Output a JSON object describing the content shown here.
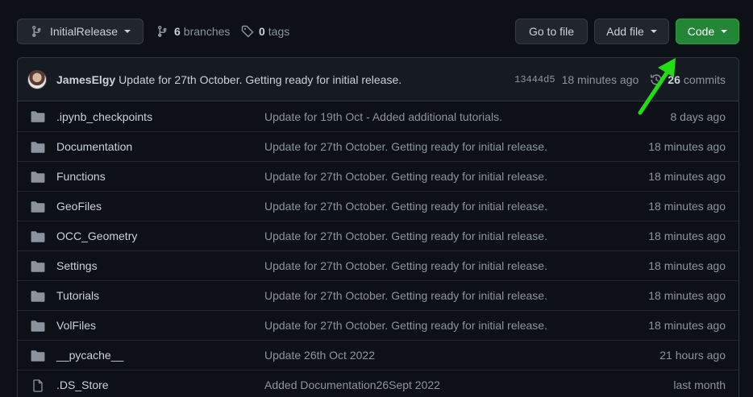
{
  "branch": {
    "name": "InitialRelease"
  },
  "branches": {
    "count": "6",
    "label": "branches"
  },
  "tags": {
    "count": "0",
    "label": "tags"
  },
  "buttons": {
    "goto": "Go to file",
    "add": "Add file",
    "code": "Code"
  },
  "commit": {
    "author": "JamesElgy",
    "message": "Update for 27th October. Getting ready for initial release.",
    "sha": "13444d5",
    "time": "18 minutes ago",
    "count": "26",
    "count_label": "commits"
  },
  "files": [
    {
      "type": "folder",
      "name": ".ipynb_checkpoints",
      "message": "Update for 19th Oct - Added additional tutorials.",
      "age": "8 days ago"
    },
    {
      "type": "folder",
      "name": "Documentation",
      "message": "Update for 27th October. Getting ready for initial release.",
      "age": "18 minutes ago"
    },
    {
      "type": "folder",
      "name": "Functions",
      "message": "Update for 27th October. Getting ready for initial release.",
      "age": "18 minutes ago"
    },
    {
      "type": "folder",
      "name": "GeoFiles",
      "message": "Update for 27th October. Getting ready for initial release.",
      "age": "18 minutes ago"
    },
    {
      "type": "folder",
      "name": "OCC_Geometry",
      "message": "Update for 27th October. Getting ready for initial release.",
      "age": "18 minutes ago"
    },
    {
      "type": "folder",
      "name": "Settings",
      "message": "Update for 27th October. Getting ready for initial release.",
      "age": "18 minutes ago"
    },
    {
      "type": "folder",
      "name": "Tutorials",
      "message": "Update for 27th October. Getting ready for initial release.",
      "age": "18 minutes ago"
    },
    {
      "type": "folder",
      "name": "VolFiles",
      "message": "Update for 27th October. Getting ready for initial release.",
      "age": "18 minutes ago"
    },
    {
      "type": "folder",
      "name": "__pycache__",
      "message": "Update 26th Oct 2022",
      "age": "21 hours ago"
    },
    {
      "type": "file",
      "name": ".DS_Store",
      "message": "Added Documentation26Sept 2022",
      "age": "last month"
    }
  ],
  "colors": {
    "accent_green": "#238636",
    "annotation_arrow": "#22dd11",
    "folder_icon": "#8b949e"
  },
  "icons": {
    "branch": "git-branch-icon",
    "tag": "tag-icon",
    "history": "history-icon",
    "folder": "folder-icon",
    "file": "file-icon",
    "annotation": "green-arrow-annotation"
  }
}
